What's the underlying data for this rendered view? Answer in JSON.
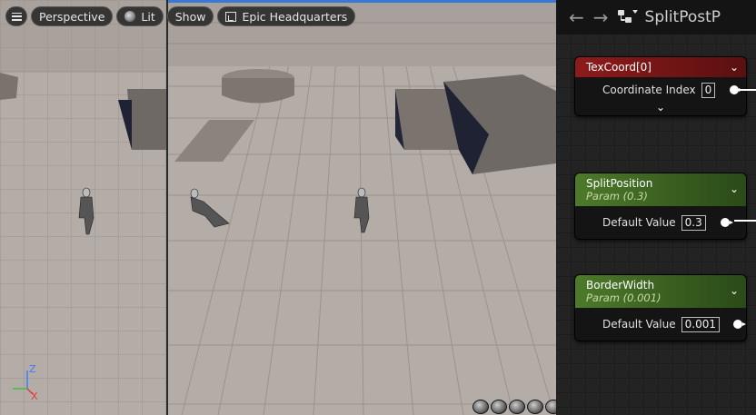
{
  "viewport": {
    "toolbar": {
      "menu_icon": "hamburger-icon",
      "perspective_label": "Perspective",
      "lit_label": "Lit",
      "show_label": "Show",
      "level_label": "Epic Headquarters"
    },
    "axis": {
      "z": "Z",
      "x": "X"
    },
    "accent_color": "#3a78d6"
  },
  "graph": {
    "toolbar": {
      "back_icon": "arrow-left-icon",
      "forward_icon": "arrow-right-icon",
      "hierarchy_icon": "hierarchy-icon",
      "title": "SplitPostP"
    },
    "nodes": [
      {
        "title": "TexCoord[0]",
        "subtitle": "",
        "color": "#8e1b1b",
        "pin_label": "Coordinate Index",
        "pin_value": "0"
      },
      {
        "title": "SplitPosition",
        "subtitle": "Param (0.3)",
        "color": "#4d7a2a",
        "pin_label": "Default Value",
        "pin_value": "0.3"
      },
      {
        "title": "BorderWidth",
        "subtitle": "Param (0.001)",
        "color": "#4d7a2a",
        "pin_label": "Default Value",
        "pin_value": "0.001"
      }
    ]
  }
}
